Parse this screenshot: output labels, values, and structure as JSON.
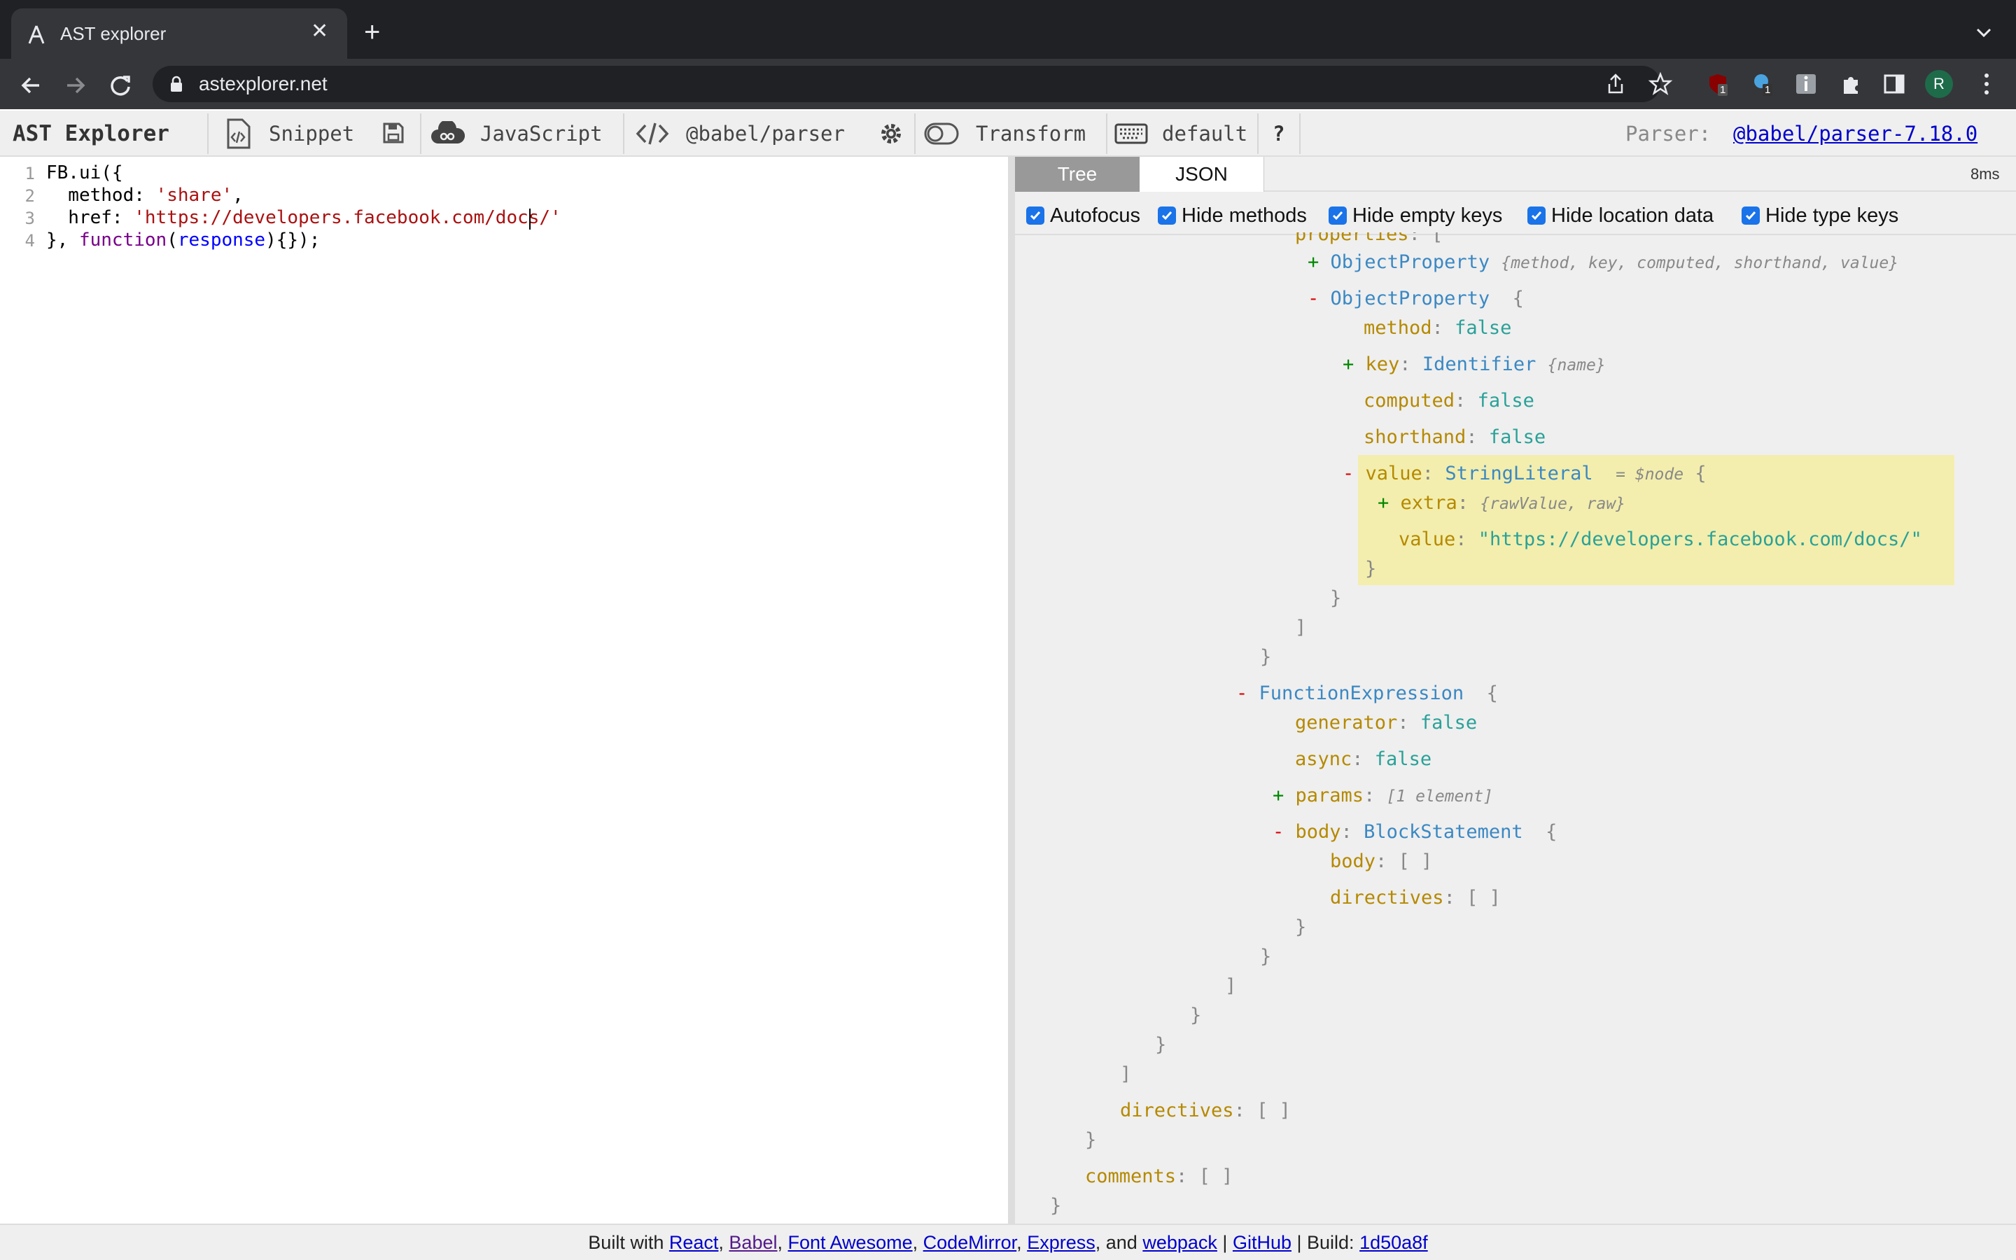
{
  "browser": {
    "tab_title": "AST explorer",
    "url": "astexplorer.net",
    "avatar_letter": "R",
    "ext_badges": [
      "1",
      "1"
    ]
  },
  "toolbar": {
    "brand": "AST Explorer",
    "snippet": "Snippet",
    "language": "JavaScript",
    "parser": "@babel/parser",
    "transform": "Transform",
    "keymap": "default",
    "help": "?",
    "parser_label": "Parser:",
    "parser_version": "@babel/parser-7.18.0"
  },
  "editor": {
    "line_numbers": [
      "1",
      "2",
      "3",
      "4"
    ],
    "line1": "FB.ui({",
    "line2_key": "  method: ",
    "line2_val": "'share'",
    "line2_end": ",",
    "line3_key": "  href: ",
    "line3_val": "'https://developers.facebook.com/docs/'",
    "line4_a": "}, ",
    "line4_kw": "function",
    "line4_b": "(",
    "line4_param": "response",
    "line4_c": "){});"
  },
  "panel": {
    "tab_tree": "Tree",
    "tab_json": "JSON",
    "timing": "8ms",
    "options": [
      "Autofocus",
      "Hide methods",
      "Hide empty keys",
      "Hide location data",
      "Hide type keys"
    ]
  },
  "tree": {
    "properties_key": "properties",
    "objprop": "ObjectProperty",
    "objprop_summary": "{method, key, computed, shorthand, value}",
    "method_key": "method",
    "key_key": "key",
    "identifier": "Identifier",
    "identifier_summary": "{name}",
    "computed_key": "computed",
    "shorthand_key": "shorthand",
    "value_key": "value",
    "string_literal": "StringLiteral",
    "node_ref": "= $node",
    "extra_key": "extra",
    "extra_summary": "{rawValue, raw}",
    "string_value": "\"https://developers.facebook.com/docs/\"",
    "false_val": "false",
    "func_expr": "FunctionExpression",
    "generator_key": "generator",
    "async_key": "async",
    "params_key": "params",
    "params_summary": "[1 element]",
    "body_key": "body",
    "block_stmt": "BlockStatement",
    "directives_key": "directives",
    "comments_key": "comments",
    "empty_array": "[ ]"
  },
  "footer": {
    "prefix": "Built with",
    "links": [
      "React",
      "Babel",
      "Font Awesome",
      "CodeMirror",
      "Express",
      "webpack",
      "GitHub"
    ],
    "and": "and",
    "build_label": "Build:",
    "build_hash": "1d50a8f"
  }
}
